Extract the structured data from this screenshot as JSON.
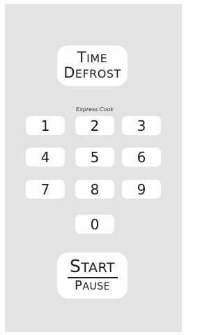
{
  "time_defrost": {
    "line1": "Time",
    "line2": "Defrost"
  },
  "express_cook_label": "Express Cook",
  "keypad": {
    "k1": "1",
    "k2": "2",
    "k3": "3",
    "k4": "4",
    "k5": "5",
    "k6": "6",
    "k7": "7",
    "k8": "8",
    "k9": "9",
    "k0": "0"
  },
  "start_pause": {
    "start": "Start",
    "pause": "Pause"
  },
  "colors": {
    "panel": "#e3e3e3",
    "button": "#ffffff",
    "text": "#1a1a1a"
  }
}
